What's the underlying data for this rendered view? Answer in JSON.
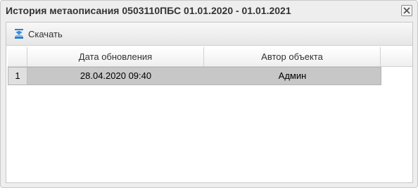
{
  "window": {
    "title": "История метаописания 0503110ПБС 01.01.2020 - 01.01.2021"
  },
  "toolbar": {
    "download_label": "Скачать",
    "download_icon": "download-icon"
  },
  "grid": {
    "columns": [
      "",
      "Дата обновления",
      "Автор объекта",
      ""
    ],
    "rows": [
      {
        "num": "1",
        "date": "28.04.2020 09:40",
        "author": "Админ",
        "selected": true
      }
    ]
  },
  "colors": {
    "selected_row": "#c7c7c7",
    "icon_blue": "#2a7fd4"
  }
}
